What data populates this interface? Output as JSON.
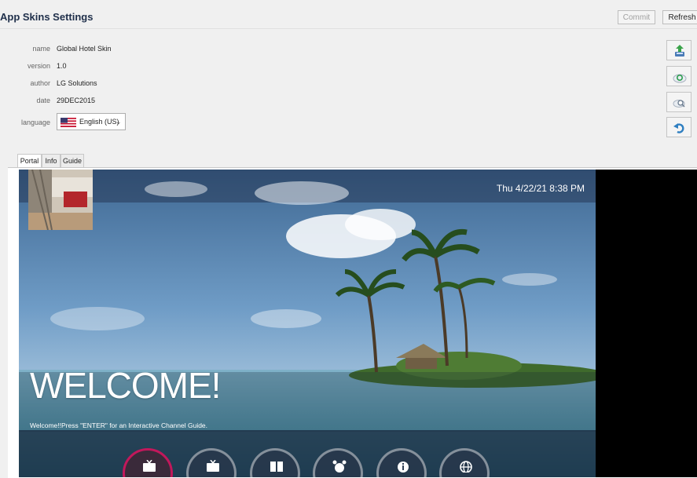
{
  "header": {
    "title": "App Skins Settings",
    "commit_label": "Commit",
    "refresh_label": "Refresh"
  },
  "meta": [
    {
      "label": "name",
      "value": "Global Hotel Skin"
    },
    {
      "label": "version",
      "value": "1.0"
    },
    {
      "label": "author",
      "value": "LG Solutions"
    },
    {
      "label": "date",
      "value": "29DEC2015"
    }
  ],
  "language": {
    "label": "language",
    "selected": "English (US)",
    "flag_icon": "us-flag-icon"
  },
  "side_buttons": [
    {
      "icon": "upload-icon"
    },
    {
      "icon": "cloud-refresh-icon"
    },
    {
      "icon": "cloud-search-icon"
    },
    {
      "icon": "undo-icon"
    }
  ],
  "tabs": [
    {
      "label": "Portal",
      "active": true
    },
    {
      "label": "Info",
      "active": false
    },
    {
      "label": "Guide",
      "active": false
    }
  ],
  "preview": {
    "datetime": "Thu 4/22/21 8:38 PM",
    "welcome_title": "WELCOME!",
    "welcome_sub": "Welcome!!Press \"ENTER\" for an Interactive Channel Guide.",
    "menu_icons": [
      "tv-icon",
      "tv-guide-icon",
      "book-icon",
      "alarm-clock-icon",
      "info-icon",
      "globe-icon"
    ]
  },
  "colors": {
    "accent": "#c2185b",
    "title_blue": "#1f2f4a"
  }
}
